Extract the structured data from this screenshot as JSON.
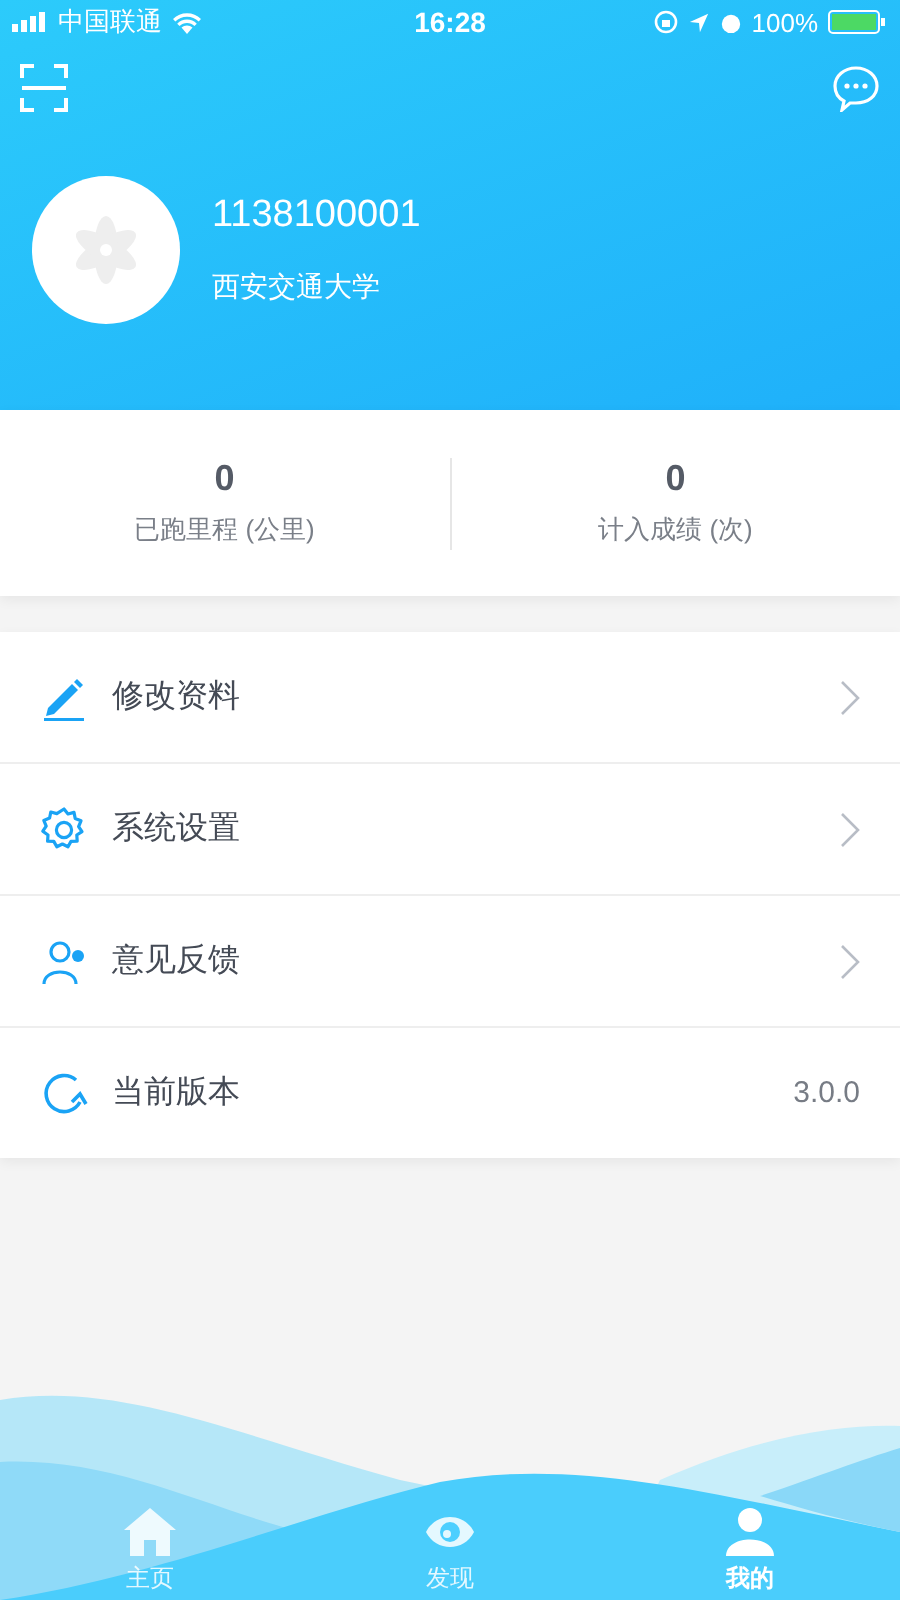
{
  "status_bar": {
    "carrier": "中国联通",
    "time": "16:28",
    "battery": "100%"
  },
  "profile": {
    "account": "1138100001",
    "school": "西安交通大学"
  },
  "stats": [
    {
      "value": "0",
      "label": "已跑里程 (公里)"
    },
    {
      "value": "0",
      "label": "计入成绩 (次)"
    }
  ],
  "menu": [
    {
      "kind": "link",
      "label": "修改资料"
    },
    {
      "kind": "link",
      "label": "系统设置"
    },
    {
      "kind": "link",
      "label": "意见反馈"
    },
    {
      "kind": "value",
      "label": "当前版本",
      "value": "3.0.0"
    }
  ],
  "tabs": [
    {
      "label": "主页",
      "selected": false
    },
    {
      "label": "发现",
      "selected": false
    },
    {
      "label": "我的",
      "selected": true
    }
  ]
}
